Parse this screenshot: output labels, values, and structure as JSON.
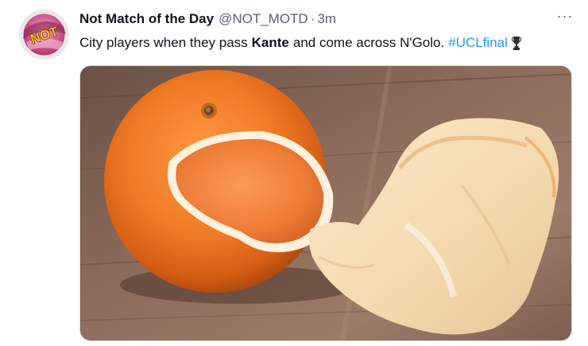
{
  "tweet": {
    "display_name": "Not Match of the Day",
    "handle": "@NOT_MOTD",
    "separator": "·",
    "time": "3m",
    "text_before": "City players when they pass",
    "text_bold": "Kante",
    "text_after": "and come across N'Golo.",
    "hashtag": "#UCLfinal",
    "more_label": "···",
    "avatar_logo_text": "NOT",
    "avatar_icon": "not-motd-logo",
    "trophy_icon": "champions-league-trophy-emoji",
    "media_icon": "peeled-orange-photo"
  },
  "colors": {
    "link": "#1d9bf0",
    "text": "#0f1419",
    "muted": "#536471"
  }
}
